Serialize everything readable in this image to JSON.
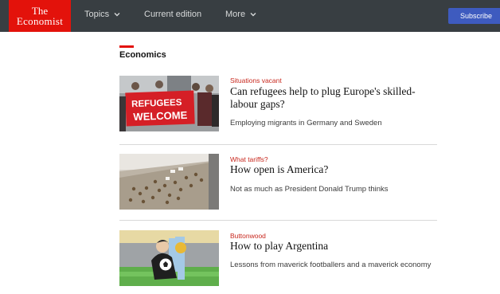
{
  "brand": {
    "logo_line1": "The",
    "logo_line2": "Economist"
  },
  "nav": {
    "topics_label": "Topics",
    "current_edition_label": "Current edition",
    "more_label": "More",
    "subscribe_label": "Subscribe"
  },
  "section": {
    "title": "Economics"
  },
  "articles": [
    {
      "kicker": "Situations vacant",
      "headline": "Can refugees help to plug Europe's skilled-labour gaps?",
      "summary": "Employing migrants in Germany and Sweden",
      "image_icon": "refugees-welcome-banner-photo",
      "banner_line1": "REFUGEES",
      "banner_line2": "WELCOME"
    },
    {
      "kicker": "What tariffs?",
      "headline": "How open is America?",
      "summary": "Not as much as President Donald Trump thinks",
      "image_icon": "conveyor-belt-photo"
    },
    {
      "kicker": "Buttonwood",
      "headline": "How to play Argentina",
      "summary": "Lessons from maverick footballers and a maverick economy",
      "image_icon": "football-illustration"
    }
  ],
  "colors": {
    "topbar": "#383e42",
    "brand_red": "#e3120b",
    "kicker_red": "#c8281e",
    "subscribe_blue": "#3e5bbf"
  }
}
